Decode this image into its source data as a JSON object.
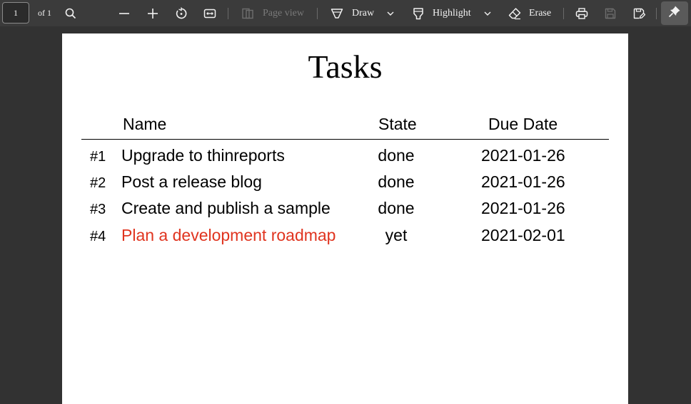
{
  "toolbar": {
    "page_number": "1",
    "page_count_label": "of 1",
    "page_view_label": "Page view",
    "draw_label": "Draw",
    "highlight_label": "Highlight",
    "erase_label": "Erase"
  },
  "document": {
    "title": "Tasks",
    "columns": {
      "name": "Name",
      "state": "State",
      "due": "Due Date"
    },
    "rows": [
      {
        "num": "#1",
        "name": "Upgrade to thinreports",
        "state": "done",
        "due": "2021-01-26"
      },
      {
        "num": "#2",
        "name": "Post a release blog",
        "state": "done",
        "due": "2021-01-26"
      },
      {
        "num": "#3",
        "name": "Create and publish a sample",
        "state": "done",
        "due": "2021-01-26"
      },
      {
        "num": "#4",
        "name": "Plan a development roadmap",
        "state": "yet",
        "due": "2021-02-01"
      }
    ]
  },
  "colors": {
    "toolbar_bg": "#3b3b3b",
    "viewer_bg": "#323232",
    "pending_task": "#e0341f"
  },
  "icons": [
    "search-icon",
    "zoom-out-icon",
    "zoom-in-icon",
    "rotate-icon",
    "fit-width-icon",
    "page-view-icon",
    "draw-icon",
    "chevron-down-icon",
    "highlight-icon",
    "erase-icon",
    "print-icon",
    "save-icon",
    "save-as-icon",
    "pin-icon"
  ]
}
